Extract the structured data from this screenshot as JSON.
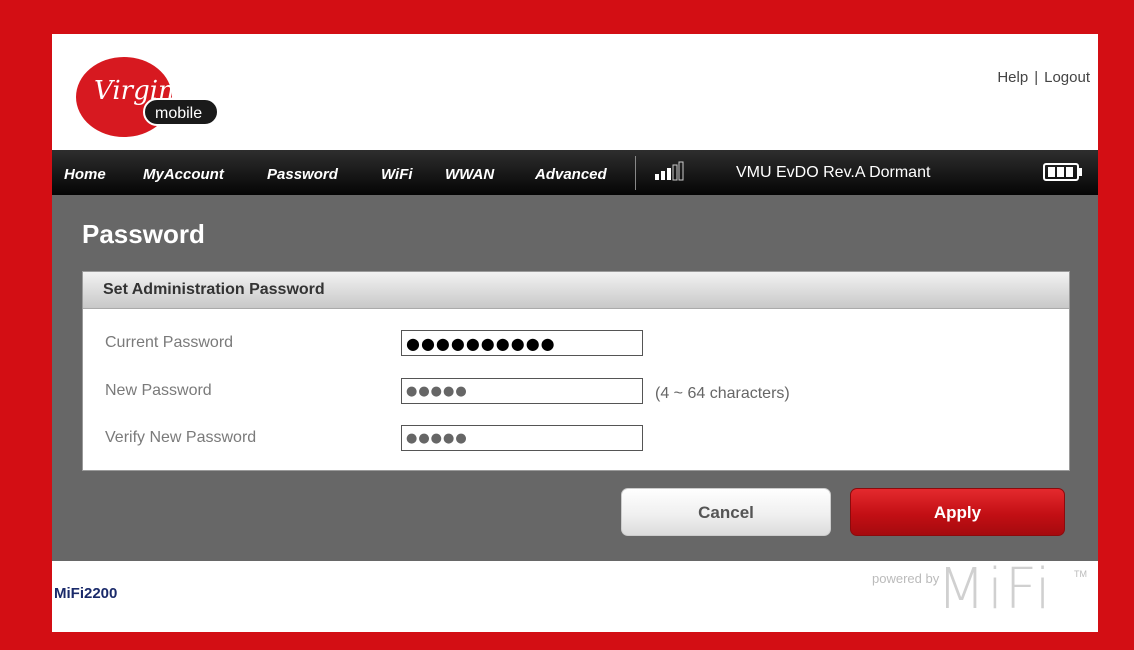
{
  "brand": {
    "logo_text_top": "Virgin",
    "logo_text_bottom": "mobile",
    "color_red": "#d30e14"
  },
  "top_links": {
    "help": "Help",
    "separator": "|",
    "logout": "Logout"
  },
  "nav": {
    "items": [
      "Home",
      "MyAccount",
      "Password",
      "WiFi",
      "WWAN",
      "Advanced"
    ],
    "status": "VMU  EvDO Rev.A  Dormant"
  },
  "page": {
    "title": "Password",
    "section_title": "Set Administration Password",
    "fields": [
      {
        "label": "Current Password",
        "value": "●●●●●●●●●●"
      },
      {
        "label": "New Password",
        "value": "●●●●●",
        "hint": "(4 ~ 64 characters)"
      },
      {
        "label": "Verify New Password",
        "value": "●●●●●"
      }
    ],
    "buttons": {
      "cancel": "Cancel",
      "apply": "Apply"
    }
  },
  "footer": {
    "model": "MiFi2200",
    "powered_by": "powered by",
    "mifi": "MiFi",
    "tm": "TM"
  }
}
